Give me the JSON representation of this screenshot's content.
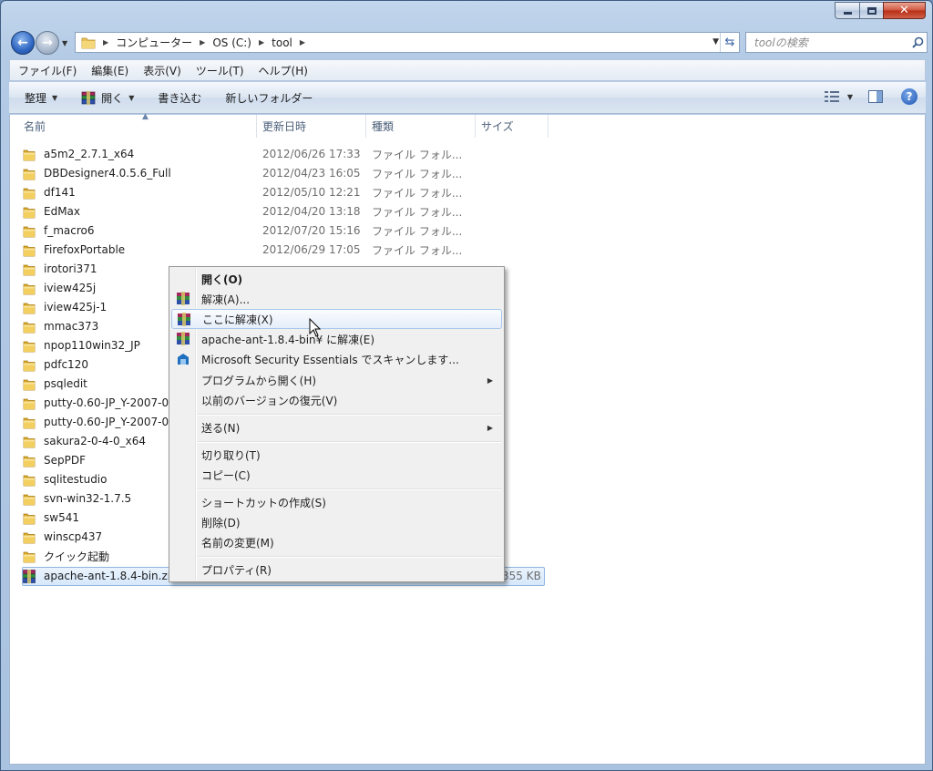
{
  "window": {
    "caption_buttons": {
      "minimize": "minimize-icon",
      "maximize": "maximize-icon",
      "close": "close-icon"
    }
  },
  "address": {
    "crumbs": [
      "コンピューター",
      "OS (C:)",
      "tool"
    ],
    "search_placeholder": "toolの検索"
  },
  "menubar": {
    "items": [
      "ファイル(F)",
      "編集(E)",
      "表示(V)",
      "ツール(T)",
      "ヘルプ(H)"
    ]
  },
  "toolbar": {
    "organize": "整理",
    "open": "開く",
    "burn": "書き込む",
    "new_folder": "新しいフォルダー"
  },
  "columns": {
    "name": "名前",
    "date": "更新日時",
    "type": "種類",
    "size": "サイズ"
  },
  "files": [
    {
      "name": "a5m2_2.7.1_x64",
      "date": "2012/06/26 17:33",
      "type": "ファイル フォル..."
    },
    {
      "name": "DBDesigner4.0.5.6_Full",
      "date": "2012/04/23 16:05",
      "type": "ファイル フォル..."
    },
    {
      "name": "df141",
      "date": "2012/05/10 12:21",
      "type": "ファイル フォル..."
    },
    {
      "name": "EdMax",
      "date": "2012/04/20 13:18",
      "type": "ファイル フォル..."
    },
    {
      "name": "f_macro6",
      "date": "2012/07/20 15:16",
      "type": "ファイル フォル..."
    },
    {
      "name": "FirefoxPortable",
      "date": "2012/06/29 17:05",
      "type": "ファイル フォル..."
    },
    {
      "name": "irotori371"
    },
    {
      "name": "iview425j"
    },
    {
      "name": "iview425j-1"
    },
    {
      "name": "mmac373"
    },
    {
      "name": "npop110win32_JP"
    },
    {
      "name": "pdfc120"
    },
    {
      "name": "psqledit"
    },
    {
      "name": "putty-0.60-JP_Y-2007-08"
    },
    {
      "name": "putty-0.60-JP_Y-2007-08"
    },
    {
      "name": "sakura2-0-4-0_x64"
    },
    {
      "name": "SepPDF"
    },
    {
      "name": "sqlitestudio"
    },
    {
      "name": "svn-win32-1.7.5"
    },
    {
      "name": "sw541"
    },
    {
      "name": "winscp437"
    },
    {
      "name": "クイック起動"
    }
  ],
  "selected_file": {
    "name": "apache-ant-1.8.4-bin.zip",
    "size": "355 KB"
  },
  "context_menu": {
    "open": "開く(O)",
    "extract": "解凍(A)...",
    "extract_here": "ここに解凍(X)",
    "extract_to": "apache-ant-1.8.4-bin¥ に解凍(E)",
    "scan": "Microsoft Security Essentials でスキャンします...",
    "open_with": "プログラムから開く(H)",
    "restore": "以前のバージョンの復元(V)",
    "send_to": "送る(N)",
    "cut": "切り取り(T)",
    "copy": "コピー(C)",
    "shortcut": "ショートカットの作成(S)",
    "delete": "削除(D)",
    "rename": "名前の変更(M)",
    "properties": "プロパティ(R)"
  }
}
